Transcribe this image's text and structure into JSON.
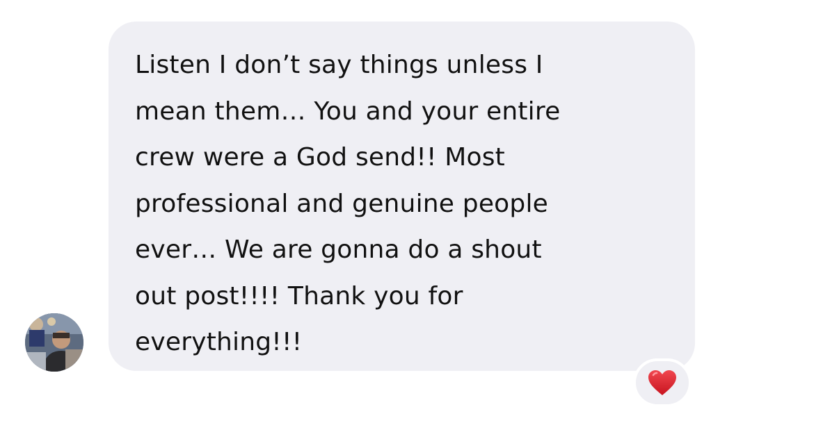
{
  "message": {
    "sender_avatar": "profile-photo",
    "lines": [
      "Listen I don’t say things unless I",
      "mean them… You and your entire",
      "crew were a God send!! Most",
      "professional and genuine people",
      "ever… We are gonna do a shout",
      "out post!!!! Thank you for",
      "everything!!!"
    ],
    "bubble_color": "#efeff4",
    "text_color": "#111111"
  },
  "reaction": {
    "icon": "red-heart-icon",
    "color": "#e0252f"
  }
}
